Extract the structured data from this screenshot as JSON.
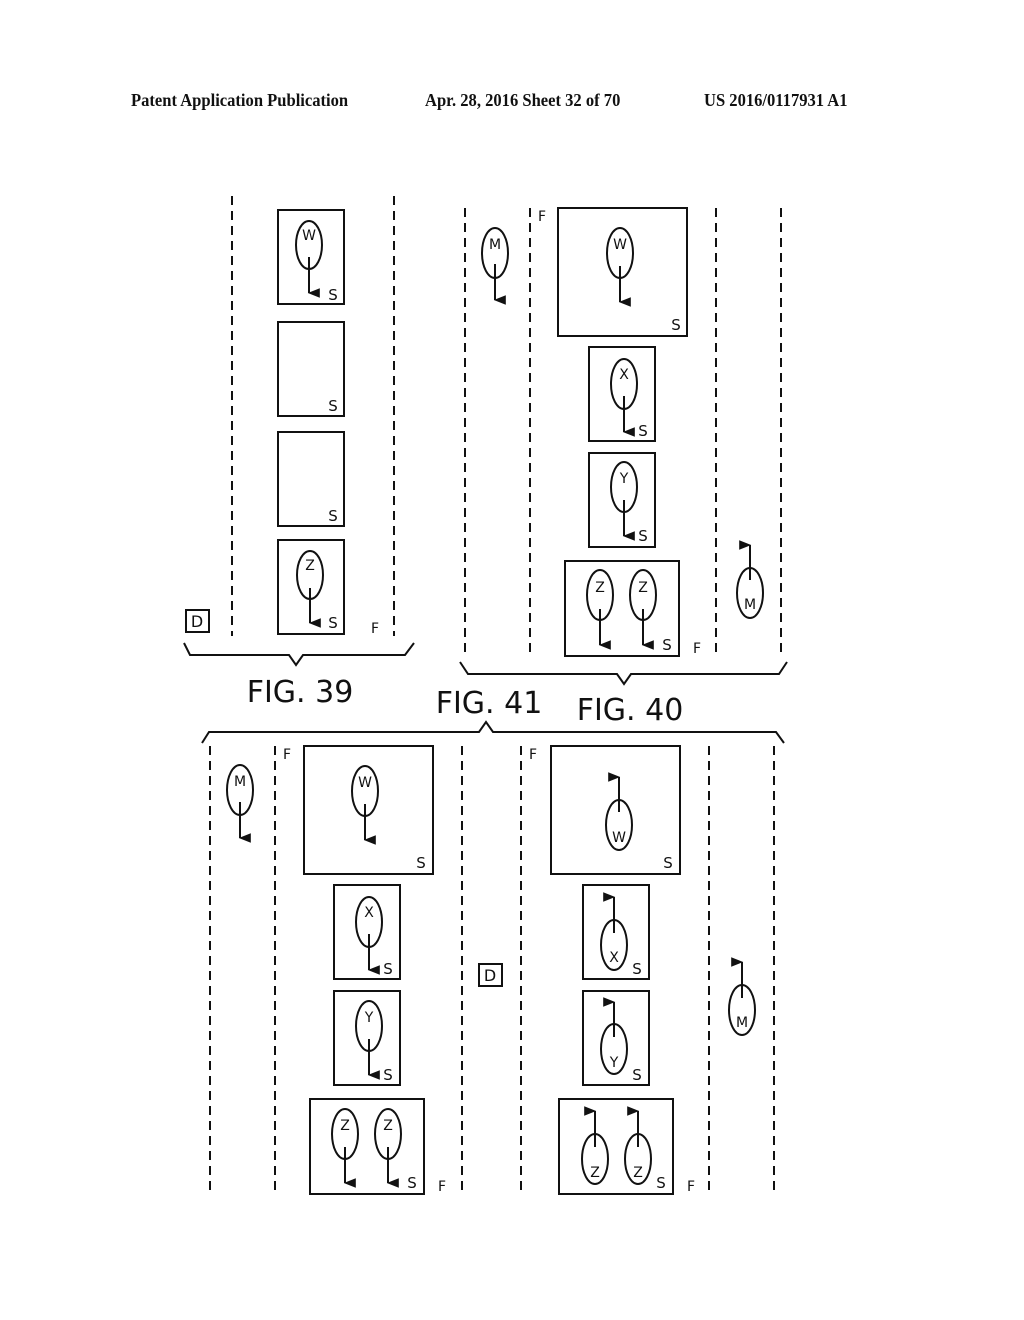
{
  "header": {
    "publication": "Patent Application Publication",
    "date_sheet": "Apr. 28, 2016  Sheet 32 of 70",
    "patent_number": "US 2016/0117931 A1"
  },
  "labels": {
    "seat": "S",
    "front": "F",
    "driver": "D",
    "occupant_w": "W",
    "occupant_x": "X",
    "occupant_y": "Y",
    "occupant_z": "Z",
    "moving": "M"
  },
  "figures": {
    "fig39": "FIG. 39",
    "fig40": "FIG. 40",
    "fig41": "FIG. 41"
  }
}
